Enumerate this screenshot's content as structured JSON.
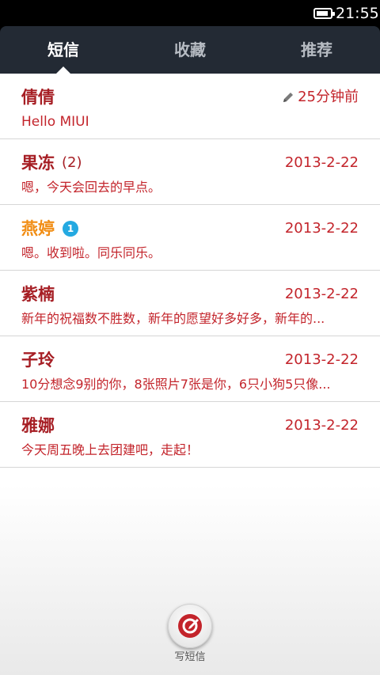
{
  "status_bar": {
    "time": "21:55",
    "battery_level": 0.9
  },
  "tabs": [
    {
      "label": "短信",
      "active": true
    },
    {
      "label": "收藏",
      "active": false
    },
    {
      "label": "推荐",
      "active": false
    }
  ],
  "conversations": [
    {
      "name": "倩倩",
      "count": "",
      "unread": "",
      "time": "25分钟前",
      "draft": true,
      "preview": "Hello MIUI"
    },
    {
      "name": "果冻",
      "count": "(2)",
      "unread": "",
      "time": "2013-2-22",
      "draft": false,
      "preview": "嗯，今天会回去的早点。"
    },
    {
      "name": "燕婷",
      "count": "",
      "unread": "1",
      "time": "2013-2-22",
      "draft": false,
      "preview": "嗯。收到啦。同乐同乐。"
    },
    {
      "name": "紫楠",
      "count": "",
      "unread": "",
      "time": "2013-2-22",
      "draft": false,
      "preview": "新年的祝福数不胜数，新年的愿望好多好多，新年的..."
    },
    {
      "name": "子玲",
      "count": "",
      "unread": "",
      "time": "2013-2-22",
      "draft": false,
      "preview": "10分想念9别的你，8张照片7张是你，6只小狗5只像..."
    },
    {
      "name": "雅娜",
      "count": "",
      "unread": "",
      "time": "2013-2-22",
      "draft": false,
      "preview": "今天周五晚上去团建吧，走起！"
    }
  ],
  "compose": {
    "label": "写短信"
  },
  "colors": {
    "accent": "#c3242b",
    "name": "#a61e24",
    "unread_name": "#f18d14",
    "badge": "#24a9e1",
    "tabbar": "#232a34"
  }
}
